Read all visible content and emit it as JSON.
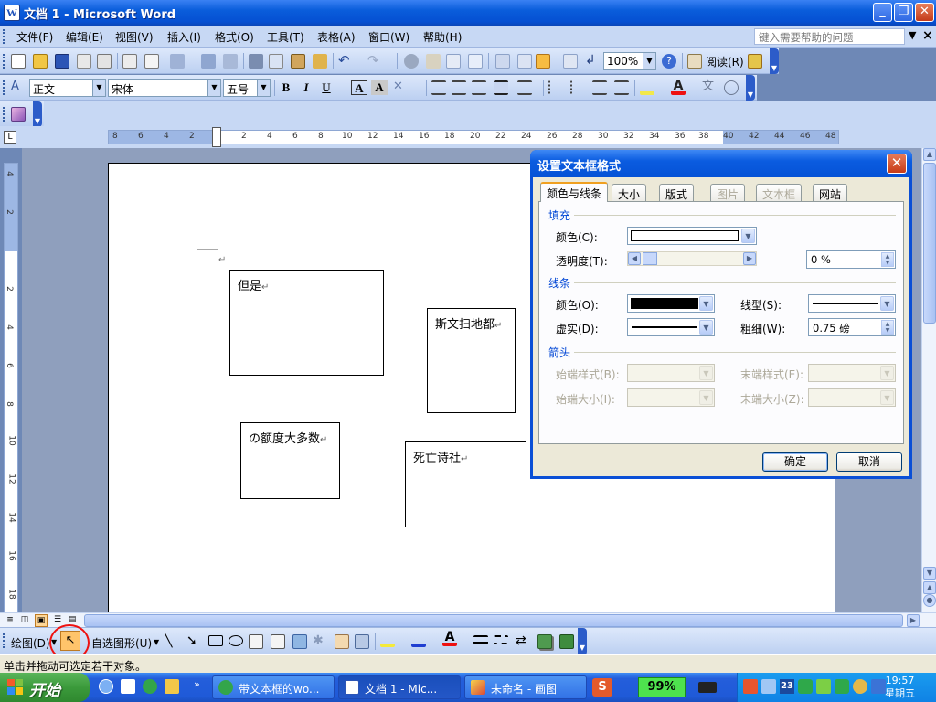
{
  "window": {
    "title": "文档 1 - Microsoft Word",
    "app_icon": "W"
  },
  "menu": {
    "items": [
      "文件(F)",
      "编辑(E)",
      "视图(V)",
      "插入(I)",
      "格式(O)",
      "工具(T)",
      "表格(A)",
      "窗口(W)",
      "帮助(H)"
    ],
    "help_placeholder": "键入需要帮助的问题"
  },
  "standard_toolbar": {
    "zoom": "100%",
    "read_label": "阅读(R)"
  },
  "format_toolbar": {
    "style": "正文",
    "font": "宋体",
    "size": "五号",
    "bold": "B",
    "italic": "I",
    "underline": "U",
    "font_color_letter": "A"
  },
  "ruler": {
    "h_ticks": [
      "8",
      "6",
      "4",
      "2",
      "2",
      "4",
      "6",
      "8",
      "10",
      "12",
      "14",
      "16",
      "18",
      "20",
      "22",
      "24",
      "26",
      "28",
      "30",
      "32",
      "34",
      "36",
      "38",
      "40",
      "42",
      "44",
      "46",
      "48"
    ],
    "v_ticks": [
      "4",
      "2",
      "2",
      "4",
      "6",
      "8",
      "10",
      "12",
      "14",
      "16",
      "18"
    ]
  },
  "document": {
    "textboxes": [
      "但是",
      "斯文扫地都",
      "の额度大多数",
      "死亡诗社"
    ],
    "paragraph_mark": "↵"
  },
  "drawing_toolbar": {
    "draw_label": "绘图(D)",
    "autoshapes_label": "自选图形(U)"
  },
  "status": {
    "text": "单击并拖动可选定若干对象。"
  },
  "taskbar": {
    "start": "开始",
    "tasks": [
      "带文本框的wo...",
      "文档 1 - Mic...",
      "未命名 - 画图"
    ],
    "battery": "99%",
    "tray_date": "23",
    "clock_time": "19:57",
    "clock_day": "星期五"
  },
  "dialog": {
    "title": "设置文本框格式",
    "tabs": [
      "颜色与线条",
      "大小",
      "版式",
      "图片",
      "文本框",
      "网站"
    ],
    "fill_section": "填充",
    "fill_color_label": "颜色(C):",
    "transparency_label": "透明度(T):",
    "transparency_value": "0 %",
    "line_section": "线条",
    "line_color_label": "颜色(O):",
    "line_type_label": "线型(S):",
    "dash_label": "虚实(D):",
    "weight_label": "粗细(W):",
    "weight_value": "0.75 磅",
    "arrow_section": "箭头",
    "begin_style_label": "始端样式(B):",
    "end_style_label": "末端样式(E):",
    "begin_size_label": "始端大小(I):",
    "end_size_label": "末端大小(Z):",
    "ok": "确定",
    "cancel": "取消",
    "colors": {
      "line_color": "#000000",
      "fill_color": "#ffffff"
    }
  }
}
